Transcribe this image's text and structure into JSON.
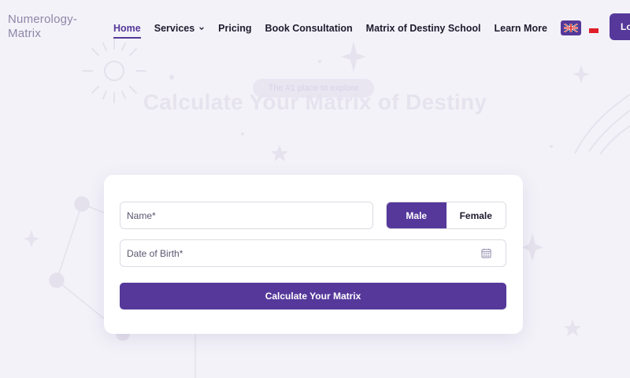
{
  "header": {
    "logo_line1": "Numerology-",
    "logo_line2": "Matrix",
    "nav": [
      {
        "label": "Home",
        "active": true
      },
      {
        "label": "Services",
        "has_dropdown": true
      },
      {
        "label": "Pricing"
      },
      {
        "label": "Book Consultation"
      },
      {
        "label": "Matrix of Destiny School"
      },
      {
        "label": "Learn More"
      }
    ],
    "lang_flags": [
      "uk-flag-icon",
      "pl-flag-icon"
    ],
    "login_label": "Lo"
  },
  "hero": {
    "pill": "The #1 place to explore",
    "title": "Calculate Your Matrix of Destiny"
  },
  "form": {
    "name_placeholder": "Name*",
    "gender_options": [
      "Male",
      "Female"
    ],
    "gender_selected": "Male",
    "dob_placeholder": "Date of Birth*",
    "submit_label": "Calculate Your Matrix"
  },
  "colors": {
    "accent": "#55389a",
    "background": "#f3f2f8",
    "flag_red": "#e11d2a"
  },
  "icons": {
    "dob": "calendar-icon",
    "services_dropdown": "chevron-down-icon"
  }
}
